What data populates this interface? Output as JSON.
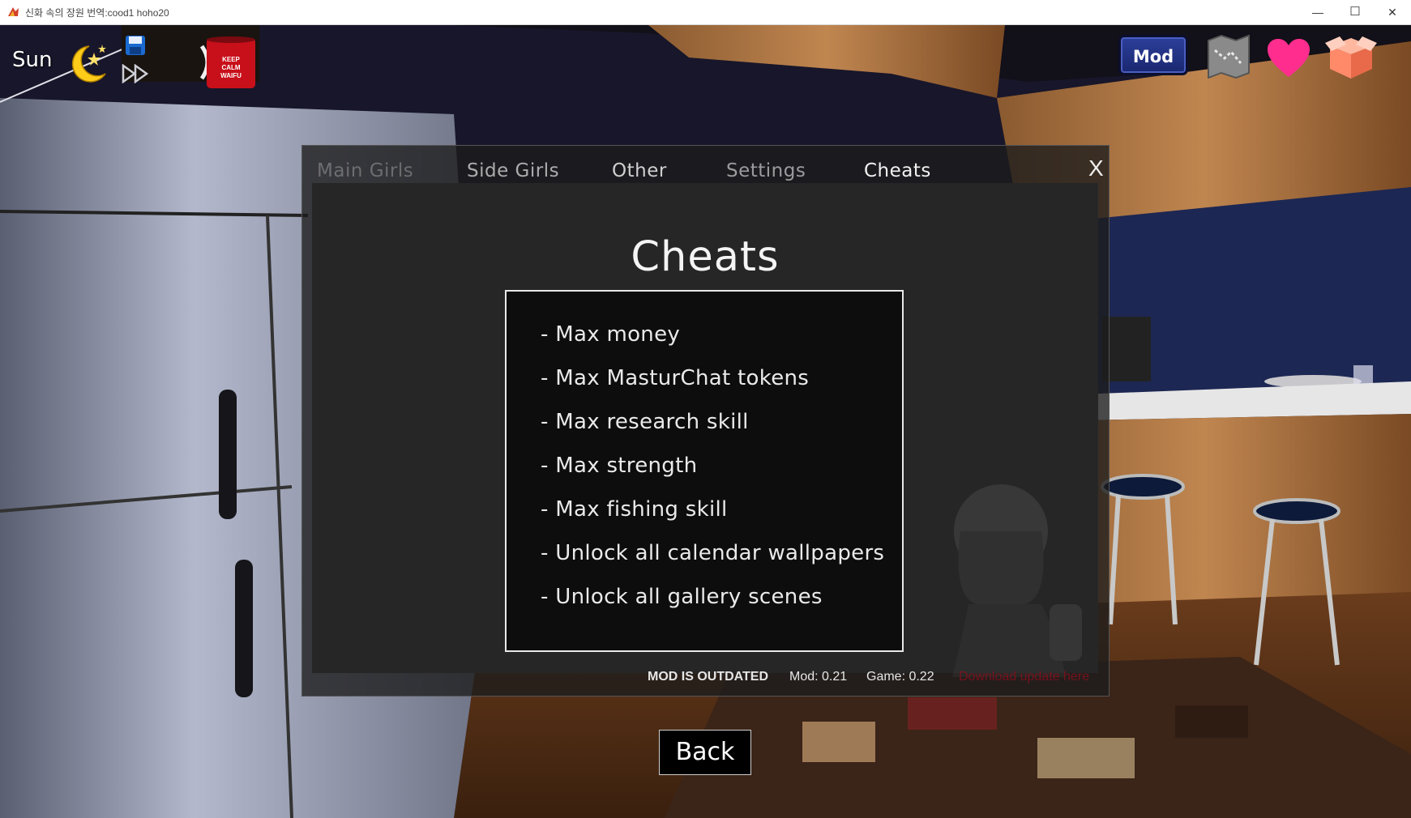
{
  "window": {
    "title": "신화 속의 장원  번역:cood1 hoho20",
    "minimize_glyph": "—",
    "maximize_glyph": "☐",
    "close_glyph": "✕"
  },
  "hud": {
    "day": "Sun",
    "mod_label": "Mod",
    "icons": [
      "moon-stars-icon",
      "save-icon",
      "fast-forward-icon",
      "mug-icon",
      "map-icon",
      "heart-icon",
      "box-icon"
    ]
  },
  "dialog": {
    "tabs": [
      {
        "label": "Main Girls"
      },
      {
        "label": "Side Girls"
      },
      {
        "label": "Other"
      },
      {
        "label": "Settings"
      },
      {
        "label": "Cheats"
      }
    ],
    "close_label": "X",
    "title": "Cheats",
    "cheats": [
      "- Max money",
      "- Max MasturChat tokens",
      "- Max research skill",
      "- Max strength",
      "- Max fishing skill",
      "- Unlock all calendar wallpapers",
      "- Unlock all gallery scenes"
    ],
    "status": {
      "outdated": "MOD IS OUTDATED",
      "mod_version": "Mod: 0.21",
      "game_version": "Game: 0.22",
      "download": "Download update here"
    }
  },
  "back_label": "Back",
  "colors": {
    "mod_button": "#1f2d82",
    "download_link": "#8a0f1f",
    "heart": "#ff2d8e"
  }
}
